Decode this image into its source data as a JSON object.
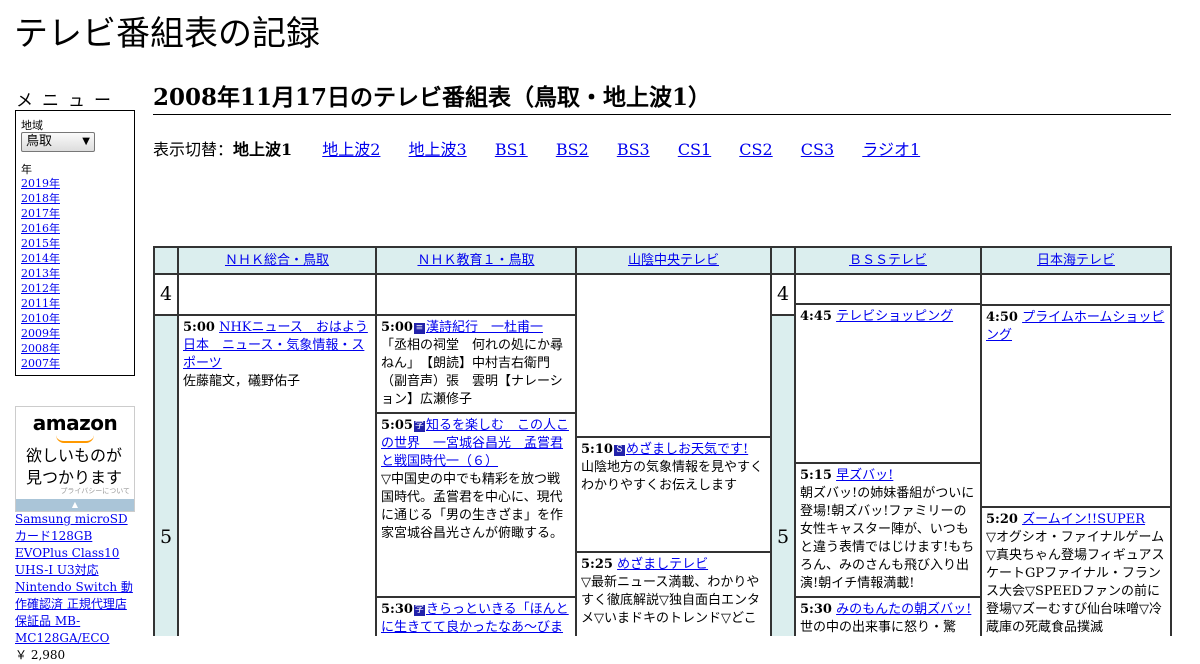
{
  "site_title": "テレビ番組表の記録",
  "menu": {
    "heading": "メニュー",
    "region_label": "地域",
    "region_value": "鳥取",
    "year_label": "年",
    "years": [
      "2019年",
      "2018年",
      "2017年",
      "2016年",
      "2015年",
      "2014年",
      "2013年",
      "2012年",
      "2011年",
      "2010年",
      "2009年",
      "2008年",
      "2007年"
    ]
  },
  "ad": {
    "logo": "amazon",
    "text_line1": "欲しいものが",
    "text_line2": "見つかります",
    "privacy": "プライバシーについて",
    "product": "Samsung microSDカード128GB EVOPlus Class10 UHS-I U3対応 Nintendo Switch 動作確認済 正規代理店保証品 MB-MC128GA/ECO",
    "price": "￥ 2,980"
  },
  "page_heading": "2008年11月17日のテレビ番組表（鳥取・地上波1）",
  "switcher": {
    "label": "表示切替：",
    "current": "地上波1",
    "links": [
      "地上波2",
      "地上波3",
      "BS1",
      "BS2",
      "BS3",
      "CS1",
      "CS2",
      "CS3",
      "ラジオ1"
    ]
  },
  "grid": {
    "channels": [
      "ＮＨＫ総合・鳥取",
      "ＮＨＫ教育１・鳥取",
      "山陰中央テレビ",
      "ＢＳＳテレビ",
      "日本海テレビ"
    ],
    "hours": [
      "4",
      "5",
      "4",
      "5"
    ],
    "programs": [
      {
        "time": "5:00",
        "icon": "",
        "title": "NHKニュース　おはよう日本　ニュース・気象情報・スポーツ",
        "desc": "佐藤龍文，礒野佑子"
      },
      {
        "time": "5:00",
        "icon": "字",
        "title": "漢詩紀行　一杜甫一",
        "desc": "「丞相の祠堂　何れの処にか尋ねん」　【朗読】中村吉右衛門　（副音声）張　雲明【ナレーション】広瀬修子"
      },
      {
        "time": "5:05",
        "icon": "字",
        "title": "知るを楽しむ　この人この世界　一宮城谷昌光　孟嘗君と戦国時代一（６）",
        "desc": "▽中国史の中でも精彩を放つ戦国時代。孟嘗君を中心に、現代に通じる「男の生きざま」を作家宮城谷昌光さんが俯瞰する。"
      },
      {
        "time": "5:30",
        "icon": "字",
        "title": "きらっといきる「ほんとに生きてて良かったなあ～びまわり",
        "desc": ""
      },
      {
        "time": "5:10",
        "icon": "S",
        "title": "めざましお天気です!",
        "desc": "山陰地方の気象情報を見やすくわかりやすくお伝えします"
      },
      {
        "time": "5:25",
        "icon": "",
        "title": "めざましテレビ",
        "desc": "▽最新ニュース満載、わかりやすく徹底解説▽独自面白エンタメ▽いまドキのトレンド▽どこ"
      },
      {
        "time": "4:45",
        "icon": "",
        "title": "テレビショッピング",
        "desc": ""
      },
      {
        "time": "5:15",
        "icon": "",
        "title": "早ズバッ!",
        "desc": "朝ズバッ!の姉妹番組がついに登場!朝ズバッ!ファミリーの女性キャスター陣が、いつもと違う表情ではじけます!もちろん、みのさんも飛び入り出演!朝イチ情報満載!"
      },
      {
        "time": "5:30",
        "icon": "",
        "title": "みのもんたの朝ズバッ!",
        "desc": "世の中の出来事に怒り・驚"
      },
      {
        "time": "4:50",
        "icon": "",
        "title": "プライムホームショッピング",
        "desc": ""
      },
      {
        "time": "5:20",
        "icon": "",
        "title": "ズームイン!!SUPER",
        "desc": "▽オグシオ・ファイナルゲーム▽真央ちゃん登場フィギュアスケートGPファイナル・フランス大会▽SPEEDファンの前に登場▽ズーむすび仙台味噌▽冷蔵庫の死蔵食品撲滅"
      }
    ]
  }
}
